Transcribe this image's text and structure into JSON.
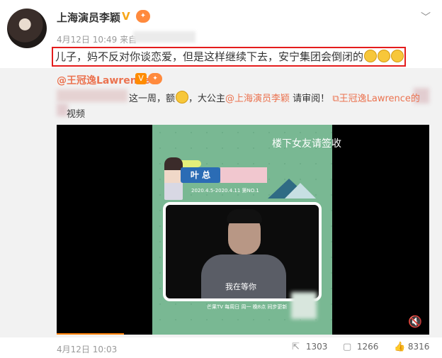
{
  "post": {
    "author": "上海演员李颖",
    "verified_badge": "V",
    "level_badge": "🐸",
    "time": "4月12日 10:49 来自",
    "text": "儿子，妈不反对你谈恋爱，但是这样继续下去，安宁集团会倒闭的",
    "emoji_count": 3,
    "menu_icon": "chevron-down-icon",
    "highlight_color": "#e41c1c"
  },
  "repost": {
    "author": "@王冠逸Lawrence",
    "verified_badge": "V",
    "level_badge": "🐸",
    "line1_a": "这一周，额",
    "line1_b": "，大公主",
    "mention": "@上海演员李颖",
    "line1_c": " 请审阅！",
    "video_link": "王冠逸Lawrence的",
    "line2": "视频",
    "link_color": "#eb7350"
  },
  "video": {
    "show_title": "楼下女友请签收",
    "name_tag": "叶 总",
    "date_range": "2020.4.5-2020.4.11  第NO.1",
    "subtitle": "我在等你",
    "footer": "芒果TV 每周日 周一 晚8点 同步更新",
    "progress": 0.18,
    "mute_icon": "mute-icon"
  },
  "footer": {
    "time": "4月12日 10:03",
    "reposts": "1303",
    "comments": "1266",
    "likes": "8316"
  }
}
